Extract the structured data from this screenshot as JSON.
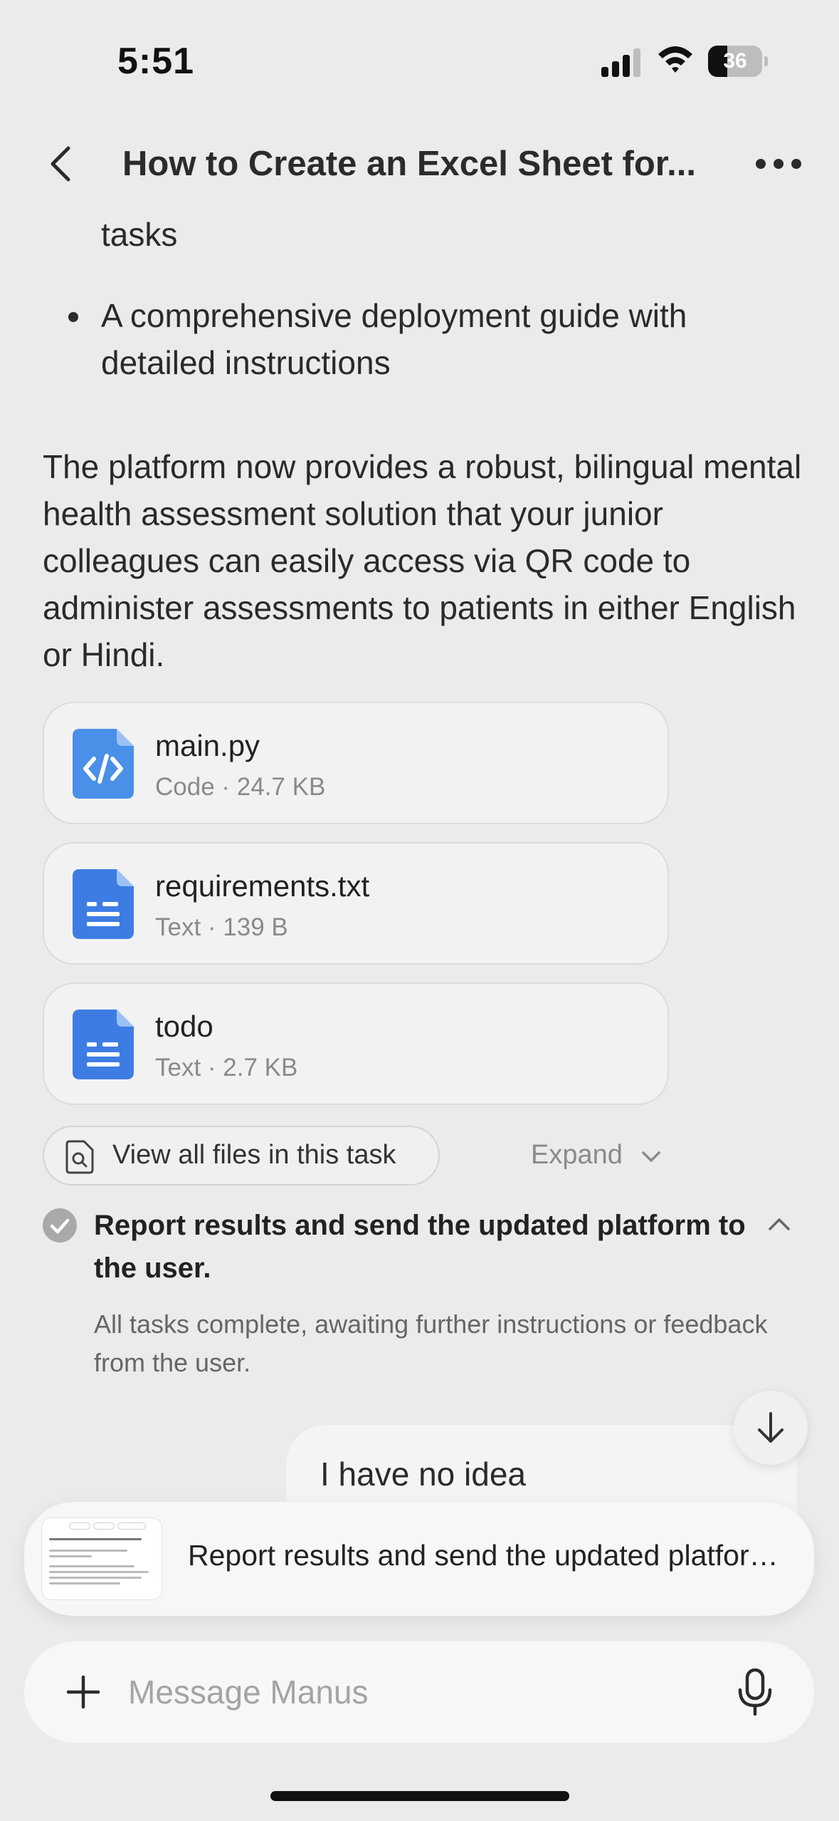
{
  "status_bar": {
    "time": "5:51",
    "battery": "36",
    "battery_level_percent": 36
  },
  "header": {
    "title": "How to Create an Excel Sheet for..."
  },
  "message": {
    "partial_bullet": "tasks",
    "bullet": "A comprehensive deployment guide with detailed instructions",
    "paragraph": "The platform now provides a robust, bilingual mental health assessment solution that your junior colleagues can easily access via QR code to administer assessments to patients in either English or Hindi."
  },
  "files": [
    {
      "name": "main.py",
      "meta": "Code · 24.7 KB",
      "icon": "code-file-icon"
    },
    {
      "name": "requirements.txt",
      "meta": "Text · 139 B",
      "icon": "text-file-icon"
    },
    {
      "name": "todo",
      "meta": "Text · 2.7 KB",
      "icon": "text-file-icon"
    }
  ],
  "files_actions": {
    "view_all": "View all files in this task",
    "expand": "Expand"
  },
  "step": {
    "title": "Report results and send the updated platform to the user.",
    "description": "All tasks complete, awaiting further instructions or feedback from the user."
  },
  "user_message": "I have no idea",
  "current_task": {
    "text": "Report results and send the updated platform to the user."
  },
  "composer": {
    "placeholder": "Message Manus"
  },
  "colors": {
    "accent_blue": "#3d7de3",
    "code_blue": "#4a8fe8",
    "background": "#ebebeb"
  }
}
